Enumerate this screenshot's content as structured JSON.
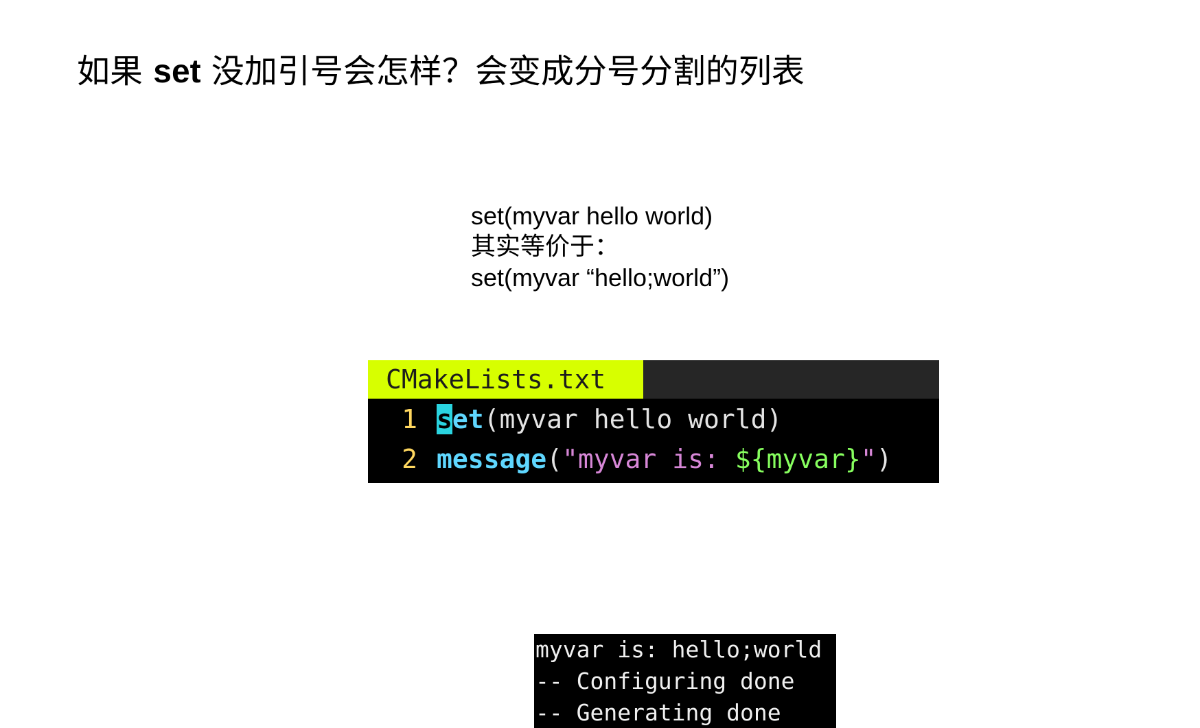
{
  "title": {
    "before": "如果 ",
    "keyword": "set",
    "after": " 没加引号会怎样？会变成分号分割的列表"
  },
  "explanation": {
    "line1": "set(myvar hello world)",
    "line2": "其实等价于：",
    "line3": "set(myvar “hello;world”)"
  },
  "editor": {
    "tab_label": "CMakeLists.txt",
    "lines": [
      {
        "number": "1",
        "cursor_char": "s",
        "command_rest": "et",
        "args": "(myvar hello world)"
      },
      {
        "number": "2",
        "command": "message",
        "open": "(",
        "string_text": "\"myvar is: ",
        "variable": "${myvar}",
        "string_close": "\"",
        "close": ")"
      }
    ],
    "colors": {
      "tab_active_bg": "#d7ff00",
      "line_number": "#ffd75f",
      "command": "#5fd7ff",
      "cursor": "#2ad4e0",
      "string": "#d787d7",
      "variable": "#87ff5f"
    }
  },
  "terminal": {
    "lines": [
      "myvar is: hello;world",
      "-- Configuring done",
      "-- Generating done"
    ]
  }
}
